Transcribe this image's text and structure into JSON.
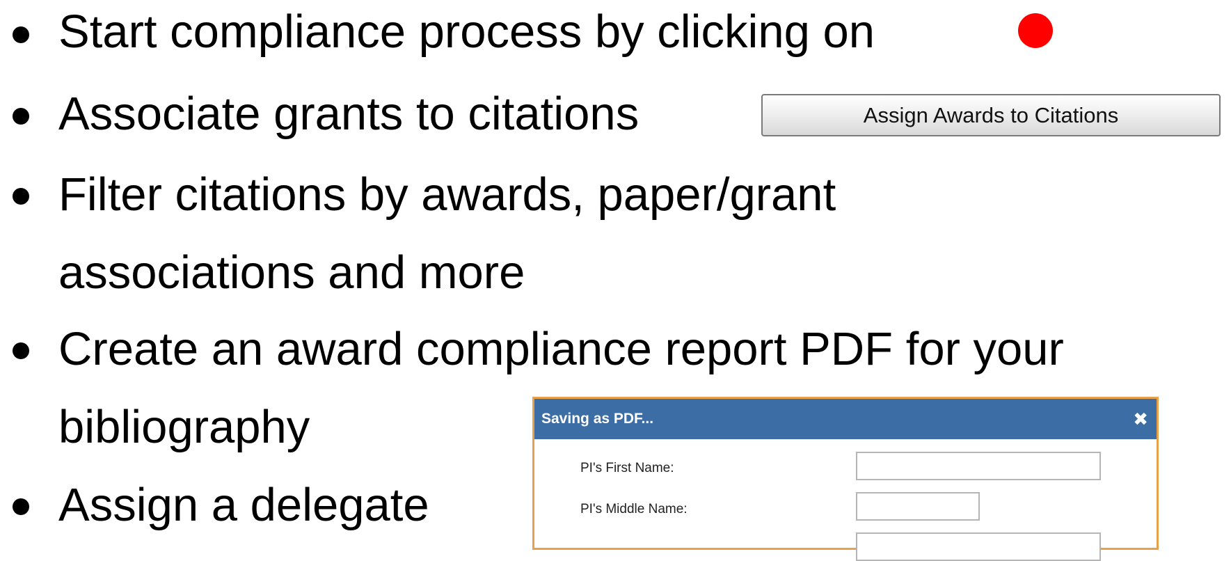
{
  "bullets": {
    "b1": "Start compliance process by clicking on",
    "b2": "Associate grants to citations",
    "b3_line1": "Filter citations by awards, paper/grant",
    "b3_line2": "associations and more",
    "b4_line1": "Create an award compliance report PDF for your",
    "b4_line2": "bibliography",
    "b5": "Assign a delegate"
  },
  "assign_button": {
    "label": "Assign Awards to Citations"
  },
  "dialog": {
    "title": "Saving as PDF...",
    "close_icon": "close-icon",
    "fields": [
      {
        "label": "PI's First Name:",
        "value": ""
      },
      {
        "label": "PI's Middle Name:",
        "value": ""
      },
      {
        "label": "",
        "value": ""
      }
    ]
  },
  "colors": {
    "red_dot": "#ff0000",
    "dialog_header": "#3d6da5",
    "dialog_border": "#e8a04a"
  }
}
